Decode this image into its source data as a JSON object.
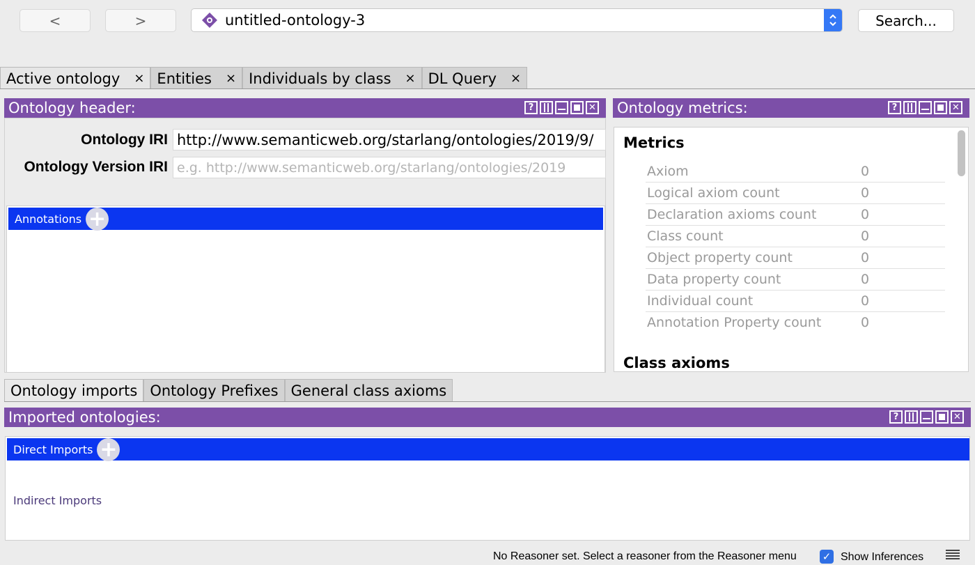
{
  "toolbar": {
    "back_label": "<",
    "forward_label": ">",
    "active_ontology": "untitled-ontology-3",
    "search_label": "Search..."
  },
  "main_tabs": [
    {
      "label": "Active ontology",
      "close": "×"
    },
    {
      "label": "Entities",
      "close": "×"
    },
    {
      "label": "Individuals by class",
      "close": "×"
    },
    {
      "label": "DL Query",
      "close": "×"
    }
  ],
  "header_panel": {
    "title": "Ontology header:",
    "iri_label": "Ontology IRI",
    "iri_value": "http://www.semanticweb.org/starlang/ontologies/2019/9/",
    "version_label": "Ontology Version IRI",
    "version_placeholder": "e.g. http://www.semanticweb.org/starlang/ontologies/2019",
    "annotations_label": "Annotations"
  },
  "metrics_panel": {
    "title": "Ontology metrics:",
    "section_metrics": "Metrics",
    "rows": [
      {
        "name": "Axiom",
        "value": "0"
      },
      {
        "name": "Logical axiom count",
        "value": "0"
      },
      {
        "name": "Declaration axioms count",
        "value": "0"
      },
      {
        "name": "Class count",
        "value": "0"
      },
      {
        "name": "Object property count",
        "value": "0"
      },
      {
        "name": "Data property count",
        "value": "0"
      },
      {
        "name": "Individual count",
        "value": "0"
      },
      {
        "name": "Annotation Property count",
        "value": "0"
      }
    ],
    "section_class_axioms": "Class axioms"
  },
  "sub_tabs": [
    {
      "label": "Ontology imports"
    },
    {
      "label": "Ontology Prefixes"
    },
    {
      "label": "General class axioms"
    }
  ],
  "imports_panel": {
    "title": "Imported ontologies:",
    "direct_label": "Direct Imports",
    "indirect_label": "Indirect Imports"
  },
  "status": {
    "reasoner_text": "No Reasoner set. Select a reasoner from the Reasoner menu",
    "show_inferences_label": "Show Inferences",
    "show_inferences_checked": true
  },
  "view_controls": {
    "help": "?"
  },
  "colors": {
    "panel_header": "#7c4fa8",
    "blue_bar": "#0b36f0",
    "select_accent": "#3478f6"
  }
}
